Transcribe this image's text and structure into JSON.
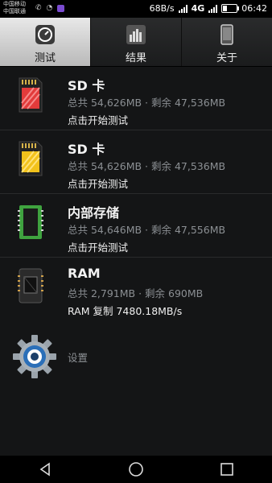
{
  "status_bar": {
    "carrier1": "中国移动",
    "carrier2": "中国联通",
    "net_speed": "68B/s",
    "network": "4G",
    "time": "06:42"
  },
  "tabs": [
    {
      "label": "测试",
      "icon": "speedometer-icon",
      "active": true
    },
    {
      "label": "结果",
      "icon": "bar-chart-icon",
      "active": false
    },
    {
      "label": "关于",
      "icon": "phone-icon",
      "active": false
    }
  ],
  "items": [
    {
      "title": "SD 卡",
      "sub": "总共 54,626MB · 剩余 47,536MB",
      "action": "点击开始测试",
      "icon": "sd-card-red-icon"
    },
    {
      "title": "SD 卡",
      "sub": "总共 54,626MB · 剩余 47,536MB",
      "action": "点击开始测试",
      "icon": "sd-card-yellow-icon"
    },
    {
      "title": "内部存储",
      "sub": "总共 54,646MB · 剩余 47,556MB",
      "action": "点击开始测试",
      "icon": "memory-chip-icon"
    },
    {
      "title": "RAM",
      "sub": "总共 2,791MB · 剩余 690MB",
      "action": "RAM 复制 7480.18MB/s",
      "icon": "ram-chip-icon"
    }
  ],
  "settings": {
    "label": "设置",
    "icon": "gear-icon"
  },
  "nav": {
    "back": "back-icon",
    "home": "home-icon",
    "recent": "recent-apps-icon"
  },
  "colors": {
    "background": "#141516",
    "tab_active": "#d0d0d0",
    "subtext": "#8b8f93"
  }
}
